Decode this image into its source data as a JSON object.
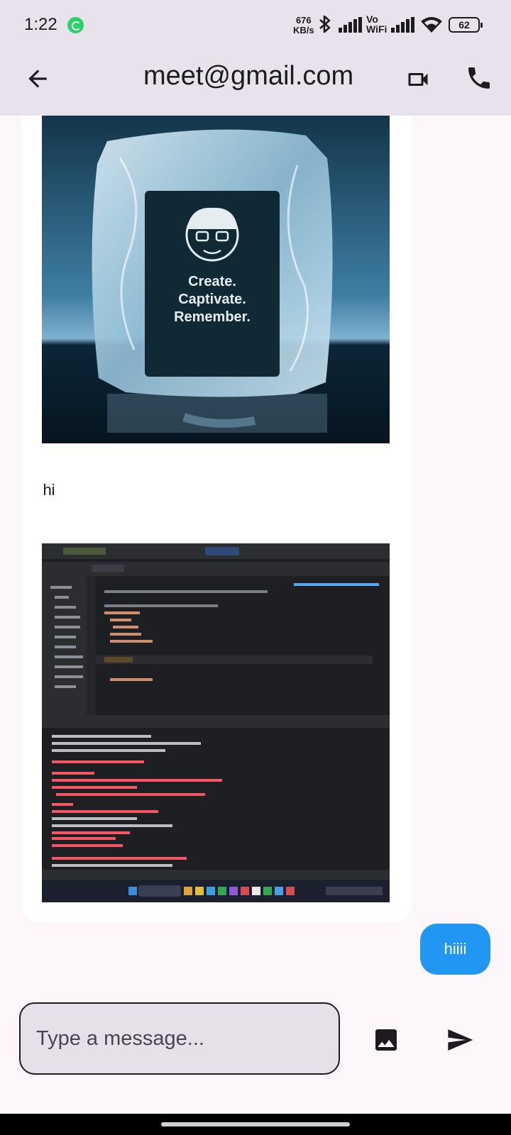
{
  "status_bar": {
    "time": "1:22",
    "net_speed_value": "676",
    "net_speed_unit": "KB/s",
    "vowifi_top": "Vo",
    "vowifi_bottom": "WiFi",
    "battery": "62",
    "icons": [
      "whatsapp-icon",
      "bluetooth-icon",
      "signal-icon",
      "vowifi-icon",
      "signal-icon",
      "wifi-icon",
      "battery-icon"
    ]
  },
  "app_bar": {
    "title": "meet@gmail.com",
    "icons": [
      "back-arrow-icon",
      "video-call-icon",
      "phone-call-icon"
    ]
  },
  "messages": [
    {
      "direction": "received",
      "type": "image",
      "image_texts": [
        "Create.",
        "Captivate.",
        "Remember."
      ]
    },
    {
      "direction": "received",
      "type": "text",
      "text": "hi"
    },
    {
      "direction": "received",
      "type": "image",
      "image_description_kind": "ide-screenshot"
    },
    {
      "direction": "sent",
      "type": "text",
      "text": "hiiii"
    }
  ],
  "composer": {
    "placeholder": "Type a message...",
    "icons": [
      "image-picker-icon",
      "send-icon"
    ]
  },
  "colors": {
    "app_bar_bg": "#e8e2ec",
    "chat_bg": "#fdf7fc",
    "received_bubble": "#ffffff",
    "sent_bubble": "#2196f3",
    "input_bg": "#e6e0e9"
  }
}
